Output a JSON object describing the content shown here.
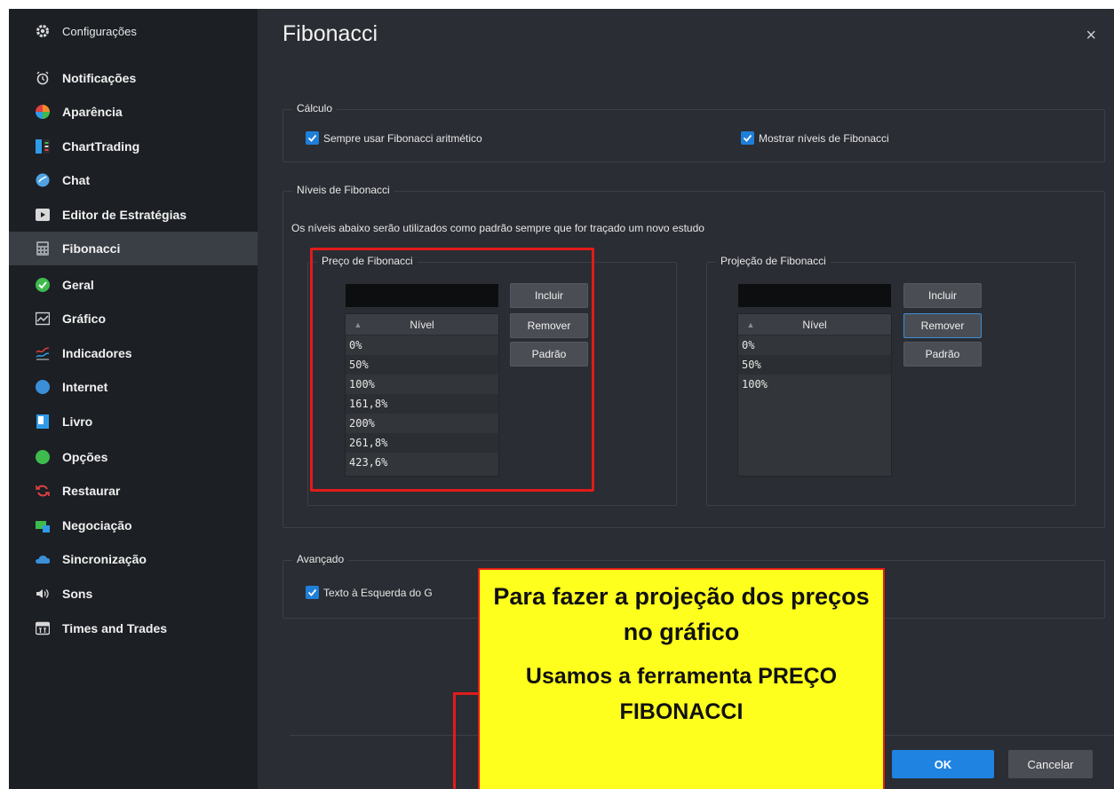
{
  "sidebar": {
    "header": "Configurações",
    "items": [
      {
        "label": "Notificações",
        "icon": "alarm-icon",
        "color": "#d8d8d8"
      },
      {
        "label": "Aparência",
        "icon": "palette-icon",
        "color": "#f28a2e"
      },
      {
        "label": "ChartTrading",
        "icon": "chart-trading-icon",
        "color": "#2f9be8"
      },
      {
        "label": "Chat",
        "icon": "chat-icon",
        "color": "#4fa3e3"
      },
      {
        "label": "Editor de Estratégias",
        "icon": "strategy-editor-icon",
        "color": "#3a6fd0"
      },
      {
        "label": "Fibonacci",
        "icon": "calculator-icon",
        "color": "#9aa0a6"
      },
      {
        "label": "Geral",
        "icon": "check-circle-icon",
        "color": "#3dbb4d"
      },
      {
        "label": "Gráfico",
        "icon": "chart-icon",
        "color": "#d0d4d8"
      },
      {
        "label": "Indicadores",
        "icon": "indicators-icon",
        "color": "#2fa0e8"
      },
      {
        "label": "Internet",
        "icon": "globe-icon",
        "color": "#3b8fd8"
      },
      {
        "label": "Livro",
        "icon": "book-icon",
        "color": "#2f9be8"
      },
      {
        "label": "Opções",
        "icon": "options-icon",
        "color": "#3dbb4d"
      },
      {
        "label": "Restaurar",
        "icon": "restore-icon",
        "color": "#e04040"
      },
      {
        "label": "Negociação",
        "icon": "trade-icon",
        "color": "#3dbb4d"
      },
      {
        "label": "Sincronização",
        "icon": "cloud-icon",
        "color": "#3b8fd8"
      },
      {
        "label": "Sons",
        "icon": "speaker-icon",
        "color": "#d8d8d8"
      },
      {
        "label": "Times and Trades",
        "icon": "times-trades-icon",
        "color": "#d8d8d8"
      }
    ]
  },
  "main": {
    "title": "Fibonacci",
    "close_glyph": "×",
    "calculo": {
      "label": "Cálculo",
      "options": [
        "Sempre usar Fibonacci aritmético",
        "Mostrar níveis de Fibonacci"
      ]
    },
    "niveis": {
      "label": "Níveis de Fibonacci",
      "description": "Os níveis abaixo serão utilizados como padrão sempre que for traçado um novo estudo",
      "preco": {
        "label": "Preço de Fibonacci",
        "column": "Nível",
        "rows": [
          "0%",
          "50%",
          "100%",
          "161,8%",
          "200%",
          "261,8%",
          "423,6%"
        ]
      },
      "projecao": {
        "label": "Projeção de Fibonacci",
        "column": "Nível",
        "rows": [
          "0%",
          "50%",
          "100%"
        ]
      },
      "buttons": {
        "incluir": "Incluir",
        "remover": "Remover",
        "padrao": "Padrão"
      }
    },
    "avancado": {
      "label": "Avançado",
      "option": "Texto à Esquerda do G"
    },
    "footer": {
      "ok": "OK",
      "cancel": "Cancelar"
    }
  },
  "annotation": {
    "line1": "Para fazer a projeção dos preços no gráfico",
    "line2": "Usamos a ferramenta PREÇO FIBONACCI",
    "callout_color": "#ffff1e",
    "highlight_color": "#e21b1b"
  },
  "colors": {
    "accent": "#1f83e2",
    "sidebar_bg": "#1c1f24",
    "panel_bg": "#2a2d33"
  }
}
